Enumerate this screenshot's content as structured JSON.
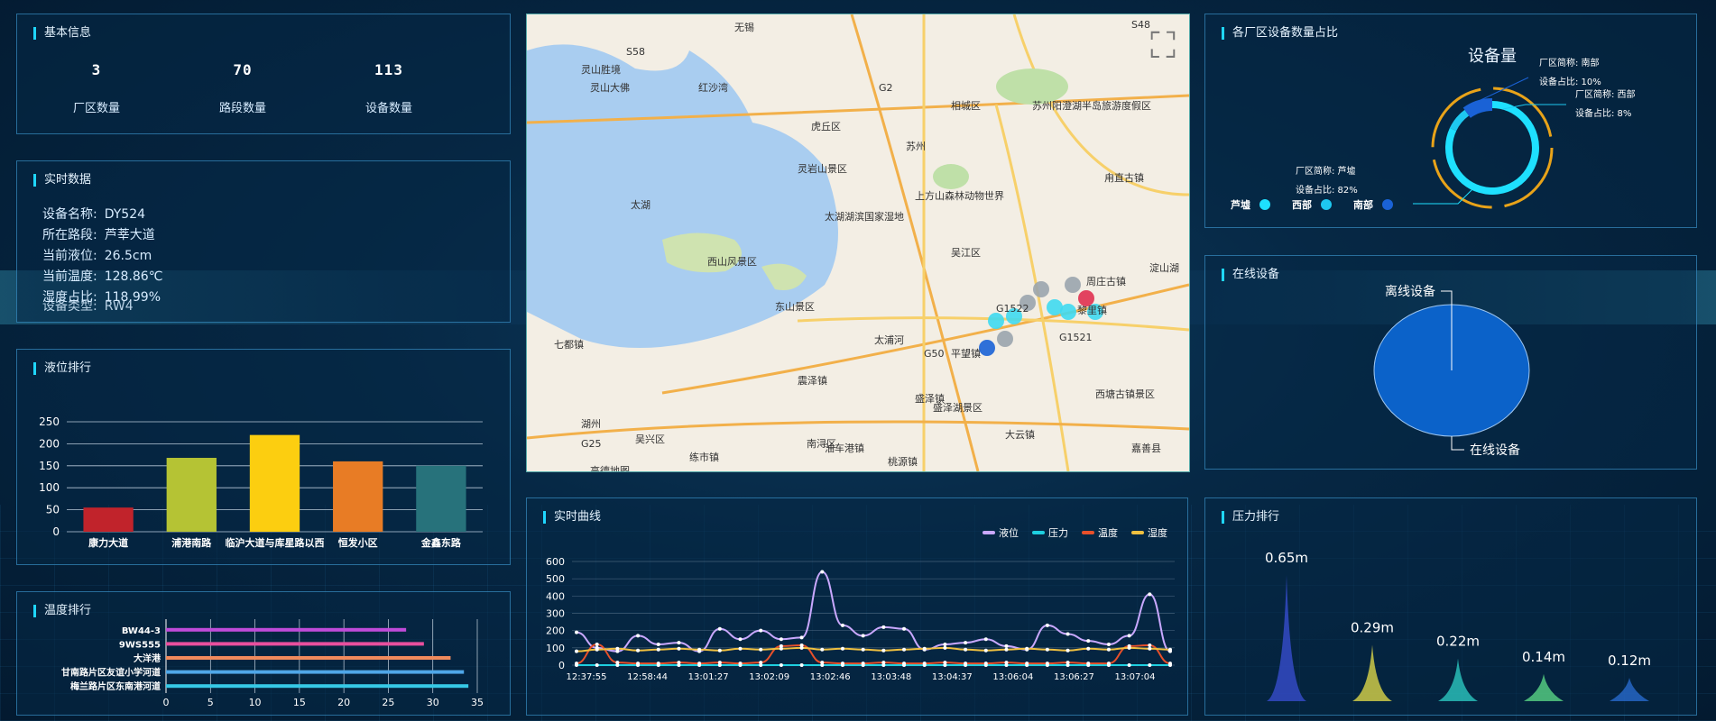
{
  "basic": {
    "title": "基本信息",
    "stats": [
      {
        "value": "3",
        "label": "厂区数量"
      },
      {
        "value": "70",
        "label": "路段数量"
      },
      {
        "value": "113",
        "label": "设备数量"
      }
    ]
  },
  "realtime": {
    "title": "实时数据",
    "rows": [
      {
        "label": "设备名称:",
        "value": "DY524"
      },
      {
        "label": "所在路段:",
        "value": "芦莘大道"
      },
      {
        "label": "当前液位:",
        "value": "26.5cm"
      },
      {
        "label": "当前温度:",
        "value": "128.86℃"
      },
      {
        "label": "湿度占比:",
        "value": "118.99%"
      },
      {
        "label": "设备类型:",
        "value": "RW4"
      }
    ]
  },
  "level_rank": {
    "title": "液位排行",
    "chart_data": {
      "type": "bar",
      "categories": [
        "康力大道",
        "浦港南路",
        "临沪大道与库星路以西",
        "恒发小区",
        "金鑫东路"
      ],
      "values": [
        55,
        168,
        220,
        160,
        150
      ],
      "colors": [
        "#c1232b",
        "#b5c334",
        "#fcce10",
        "#e87c25",
        "#27727b"
      ],
      "ylim": [
        0,
        250
      ],
      "yticks": [
        0,
        50,
        100,
        150,
        200,
        250
      ]
    }
  },
  "temp_rank": {
    "title": "温度排行",
    "chart_data": {
      "type": "bar",
      "orientation": "horizontal",
      "categories": [
        "BW44-3",
        "9WS555",
        "大洋港",
        "甘南路片区友谊小学河道",
        "梅兰路片区东南港河道"
      ],
      "values": [
        27,
        29,
        32,
        33.5,
        34
      ],
      "colors": [
        "#c04bd9",
        "#e84f9e",
        "#f08a5c",
        "#4fa7e8",
        "#36c9e6"
      ],
      "xlim": [
        0,
        35
      ],
      "xticks": [
        0,
        5,
        10,
        15,
        20,
        25,
        30,
        35
      ]
    }
  },
  "map": {
    "labels": [
      "无锡",
      "苏州",
      "太湖",
      "虎丘区",
      "相城区",
      "灵岩山景区",
      "上方山森林动物世界",
      "太湖湖滨国家湿地",
      "西山风景区",
      "东山景区",
      "吴江区",
      "湖州",
      "吴兴区",
      "南浔区",
      "周庄古镇",
      "西塘古镇景区",
      "嘉善县",
      "黎里镇",
      "太浦河",
      "盛泽湖景区",
      "苏州阳澄湖半岛旅游度假区",
      "灵山胜境",
      "灵山大佛",
      "红沙湾",
      "甪直古镇",
      "淀山湖",
      "七都镇",
      "震泽镇",
      "平望镇",
      "盛泽镇",
      "桃源镇",
      "练市镇",
      "油车港镇",
      "大云镇",
      "高德地图",
      "G2",
      "G50",
      "G1522",
      "G1521",
      "S58",
      "S48",
      "G25"
    ]
  },
  "factory": {
    "title": "各厂区设备数量占比",
    "center_label": "设备量",
    "callouts": [
      {
        "name_label": "厂区简称:",
        "name": "南部",
        "ratio_label": "设备占比:",
        "ratio": "10%"
      },
      {
        "name_label": "厂区简称:",
        "name": "西部",
        "ratio_label": "设备占比:",
        "ratio": "8%"
      },
      {
        "name_label": "厂区简称:",
        "name": "芦墟",
        "ratio_label": "设备占比:",
        "ratio": "82%"
      }
    ],
    "legend": [
      {
        "name": "芦墟",
        "color": "#1ee0ff"
      },
      {
        "name": "西部",
        "color": "#1ec8f0"
      },
      {
        "name": "南部",
        "color": "#1a62d6"
      }
    ],
    "chart_data": {
      "type": "pie",
      "categories": [
        "芦墟",
        "西部",
        "南部"
      ],
      "values": [
        82,
        8,
        10
      ]
    }
  },
  "online": {
    "title": "在线设备",
    "offline_label": "离线设备",
    "online_label": "在线设备",
    "chart_data": {
      "type": "pie",
      "categories": [
        "在线设备",
        "离线设备"
      ],
      "values": [
        100,
        0
      ],
      "colors": [
        "#0b62c9",
        "#ffffff"
      ]
    }
  },
  "curve": {
    "title": "实时曲线",
    "legend": [
      {
        "name": "液位",
        "color": "#c9a8ff"
      },
      {
        "name": "压力",
        "color": "#1ecfe0"
      },
      {
        "name": "温度",
        "color": "#e8502a"
      },
      {
        "name": "湿度",
        "color": "#f0c040"
      }
    ],
    "chart_data": {
      "type": "line",
      "x": [
        "12:37:55",
        "12:58:44",
        "13:01:27",
        "13:02:09",
        "13:02:46",
        "13:03:48",
        "13:04:37",
        "13:06:04",
        "13:06:27",
        "13:07:04"
      ],
      "ylim": [
        0,
        600
      ],
      "yticks": [
        0,
        100,
        200,
        300,
        400,
        500,
        600
      ],
      "series": [
        {
          "name": "液位",
          "values": [
            190,
            100,
            80,
            170,
            120,
            130,
            80,
            210,
            150,
            200,
            150,
            160,
            540,
            230,
            170,
            220,
            210,
            90,
            120,
            130,
            150,
            110,
            90,
            230,
            180,
            140,
            120,
            170,
            410,
            80
          ]
        },
        {
          "name": "压力",
          "values": [
            0,
            0,
            0,
            0,
            0,
            0,
            0,
            0,
            0,
            0,
            0,
            0,
            0,
            0,
            0,
            0,
            0,
            0,
            0,
            0,
            0,
            0,
            0,
            0,
            0,
            0,
            0,
            0,
            0,
            0
          ]
        },
        {
          "name": "温度",
          "values": [
            10,
            120,
            15,
            10,
            10,
            15,
            10,
            15,
            10,
            15,
            110,
            115,
            15,
            10,
            10,
            15,
            10,
            10,
            15,
            10,
            10,
            15,
            10,
            10,
            15,
            10,
            10,
            110,
            115,
            10
          ]
        },
        {
          "name": "湿度",
          "values": [
            80,
            90,
            95,
            85,
            90,
            95,
            90,
            85,
            95,
            90,
            95,
            100,
            90,
            95,
            90,
            85,
            90,
            95,
            100,
            90,
            85,
            90,
            95,
            90,
            85,
            95,
            90,
            100,
            95,
            90
          ]
        }
      ]
    }
  },
  "pressure": {
    "title": "压力排行",
    "chart_data": {
      "type": "bar",
      "style": "peak",
      "values": [
        0.65,
        0.29,
        0.22,
        0.14,
        0.12
      ],
      "value_labels": [
        "0.65m",
        "0.29m",
        "0.22m",
        "0.14m",
        "0.12m"
      ],
      "colors": [
        "#3a4fd6",
        "#e8e04a",
        "#2ed1c8",
        "#5ee08a",
        "#2a6fd6"
      ]
    }
  }
}
